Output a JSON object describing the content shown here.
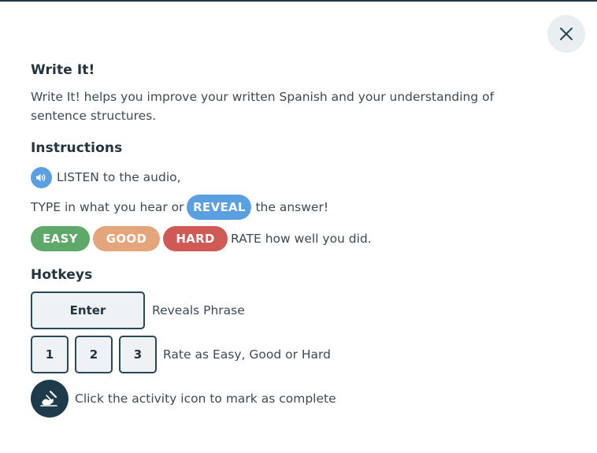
{
  "dialog": {
    "title": "Write It!",
    "description": "Write It! helps you improve your written Spanish and your understanding of sentence structures.",
    "close_icon": "close-icon"
  },
  "instructions": {
    "heading": "Instructions",
    "listen_text": "LISTEN to the audio,",
    "audio_icon": "speaker-icon",
    "type_text": "TYPE in what you hear or",
    "reveal_label": "REVEAL",
    "reveal_suffix": "the answer!",
    "rate_buttons": {
      "easy": "EASY",
      "good": "GOOD",
      "hard": "HARD"
    },
    "rate_text": "RATE how well you did."
  },
  "hotkeys": {
    "heading": "Hotkeys",
    "enter_key": "Enter",
    "enter_desc": "Reveals Phrase",
    "num_keys": [
      "1",
      "2",
      "3"
    ],
    "num_desc": "Rate as Easy, Good or Hard",
    "activity_desc": "Click the activity icon to mark as complete",
    "activity_icon": "write-hand-icon"
  },
  "colors": {
    "accent_blue": "#5aa0e0",
    "easy_green": "#5ea86a",
    "good_orange": "#e5a57b",
    "hard_red": "#cf5a55",
    "dark_navy": "#1e3b4c"
  }
}
